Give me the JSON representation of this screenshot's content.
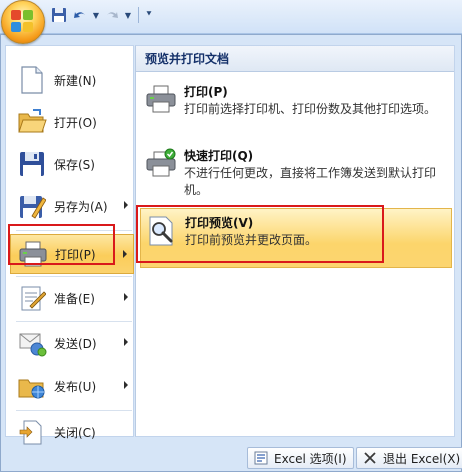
{
  "quick_access": {
    "items": [
      {
        "name": "save",
        "icon": "save-icon"
      },
      {
        "name": "undo",
        "icon": "undo-icon"
      },
      {
        "name": "redo",
        "icon": "redo-icon"
      },
      {
        "name": "customize",
        "icon": "dropdown-icon"
      }
    ]
  },
  "left_menu": {
    "items": [
      {
        "label": "新建(N)",
        "icon": "new-document-icon",
        "has_submenu": false
      },
      {
        "label": "打开(O)",
        "icon": "open-folder-icon",
        "has_submenu": false
      },
      {
        "label": "保存(S)",
        "icon": "save-floppy-icon",
        "has_submenu": false
      },
      {
        "label": "另存为(A)",
        "icon": "save-as-icon",
        "has_submenu": true
      },
      {
        "label": "打印(P)",
        "icon": "printer-icon",
        "has_submenu": true,
        "active": true
      },
      {
        "label": "准备(E)",
        "icon": "prepare-icon",
        "has_submenu": true
      },
      {
        "label": "发送(D)",
        "icon": "send-icon",
        "has_submenu": true
      },
      {
        "label": "发布(U)",
        "icon": "publish-icon",
        "has_submenu": true
      },
      {
        "label": "关闭(C)",
        "icon": "close-document-icon",
        "has_submenu": false
      }
    ]
  },
  "right_panel": {
    "header": "预览并打印文档",
    "items": [
      {
        "title": "打印(P)",
        "description": "打印前选择打印机、打印份数及其他打印选项。",
        "icon": "printer-icon"
      },
      {
        "title": "快速打印(Q)",
        "description": "不进行任何更改，直接将工作簿发送到默认打印机。",
        "icon": "quick-print-icon"
      },
      {
        "title": "打印预览(V)",
        "description": "打印前预览并更改页面。",
        "icon": "print-preview-icon",
        "active": true
      }
    ]
  },
  "bottom_buttons": {
    "options_label": "Excel 选项(I)",
    "exit_label": "退出 Excel(X)"
  },
  "colors": {
    "highlight_border": "#d9191b",
    "menu_background": "#d6e5f7",
    "active_gradient": "#fbcd5a"
  }
}
